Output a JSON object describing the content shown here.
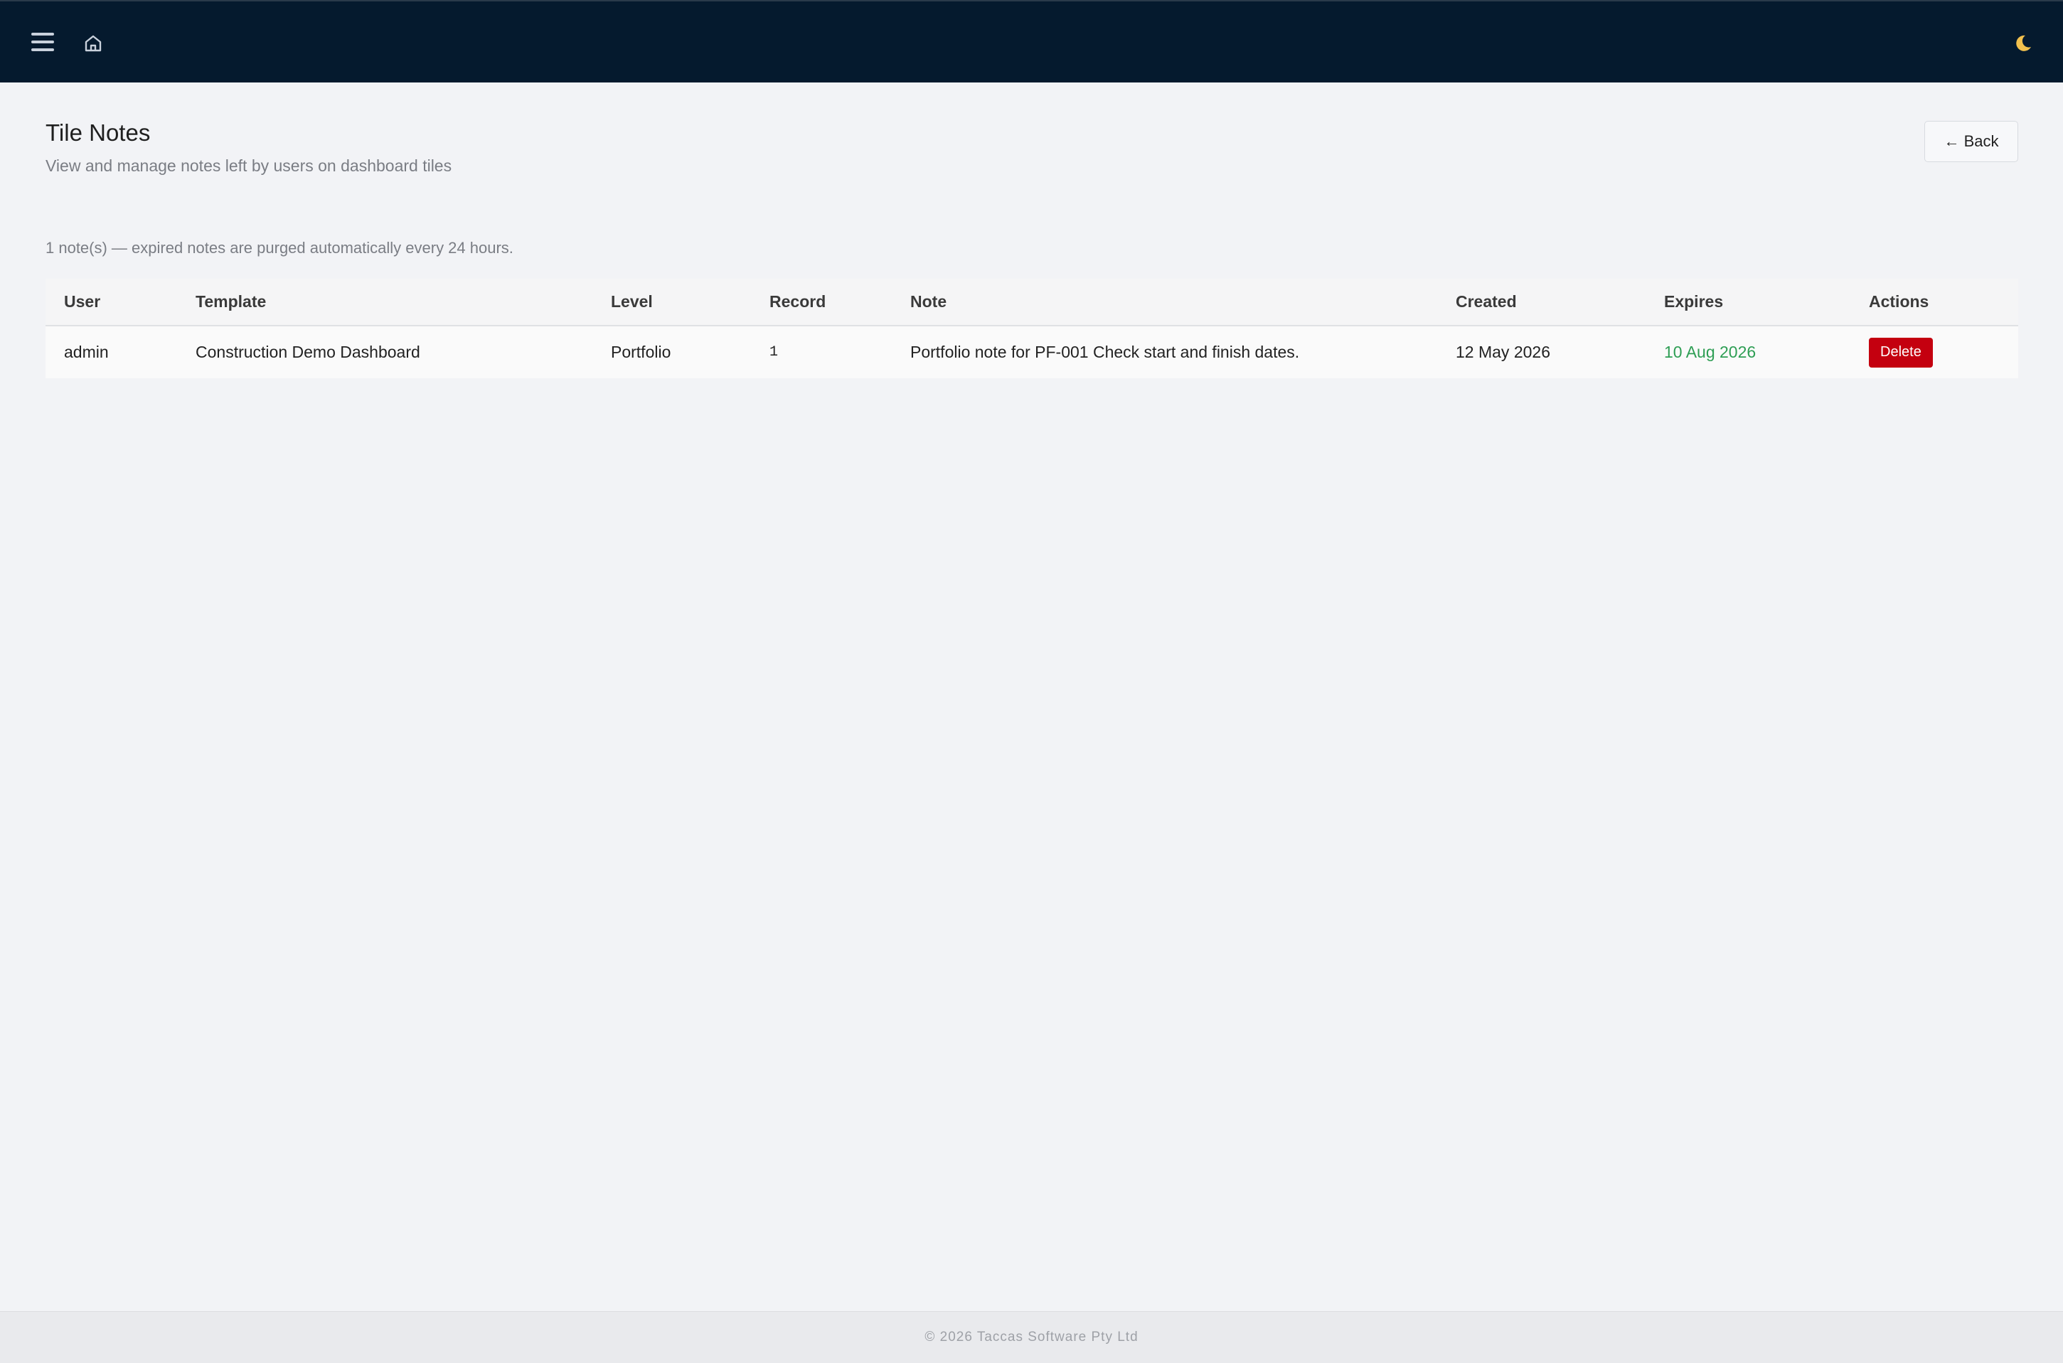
{
  "colors": {
    "topbar_bg": "#051a2e",
    "page_bg": "#f2f3f6",
    "delete_red": "#c4000f",
    "expires_green": "#2e9e54",
    "moon_yellow": "#f2c14e"
  },
  "topbar": {
    "menu_icon": "hamburger-menu-icon",
    "home_icon": "home-icon",
    "theme_icon": "moon-icon"
  },
  "page": {
    "title": "Tile Notes",
    "subtitle": "View and manage notes left by users on dashboard tiles",
    "back_label": "← Back",
    "count_text": "1 note(s) — expired notes are purged automatically every 24 hours."
  },
  "table": {
    "headers": {
      "user": "User",
      "template": "Template",
      "level": "Level",
      "record": "Record",
      "note": "Note",
      "created": "Created",
      "expires": "Expires",
      "actions": "Actions"
    },
    "rows": [
      {
        "user": "admin",
        "template": "Construction Demo Dashboard",
        "level": "Portfolio",
        "record": "1",
        "note": "Portfolio note for PF-001 Check start and finish dates.",
        "created": "12 May 2026",
        "expires": "10 Aug 2026",
        "action_label": "Delete"
      }
    ]
  },
  "footer": {
    "text": "© 2026 Taccas Software Pty Ltd"
  }
}
